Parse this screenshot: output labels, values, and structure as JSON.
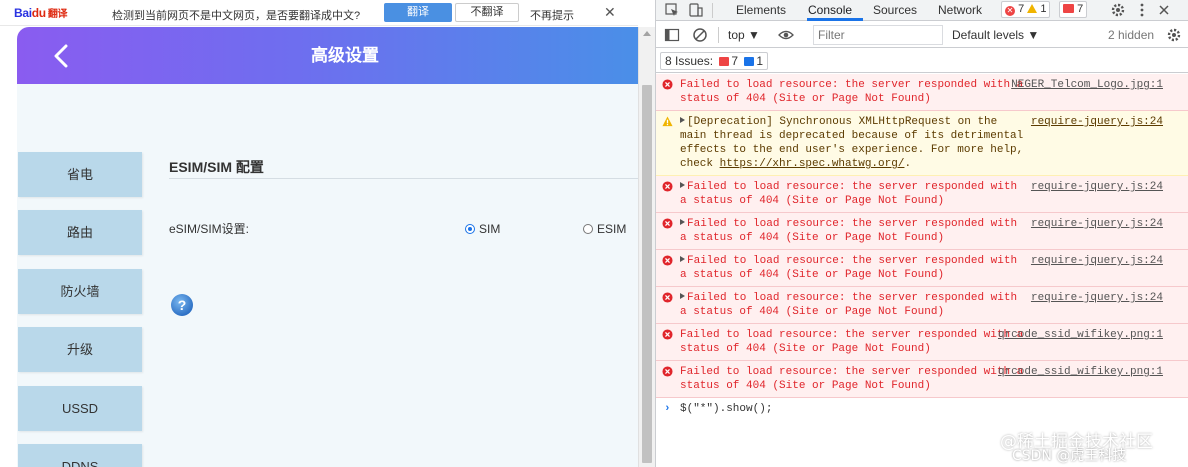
{
  "translate_bar": {
    "logo_text": "Bai",
    "logo_accent": "du",
    "logo_suffix": "翻译",
    "message": "检测到当前网页不是中文网页，是否要翻译成中文?",
    "translate_label": "翻译",
    "no_translate_label": "不翻译",
    "no_prompt_label": "不再提示",
    "close_glyph": "✕"
  },
  "page": {
    "header_title": "高级设置",
    "sidebar": [
      {
        "label": "省电"
      },
      {
        "label": "路由"
      },
      {
        "label": "防火墙"
      },
      {
        "label": "升级"
      },
      {
        "label": "USSD"
      },
      {
        "label": "DDNS"
      }
    ],
    "section_title": "ESIM/SIM 配置",
    "field_label": "eSIM/SIM设置:",
    "options": [
      {
        "label": "SIM",
        "selected": true
      },
      {
        "label": "ESIM",
        "selected": false
      }
    ],
    "help_glyph": "?"
  },
  "devtools": {
    "tabs": [
      "Elements",
      "Console",
      "Sources",
      "Network"
    ],
    "active_tab": "Console",
    "error_count": "7",
    "warning_count": "1",
    "issue_count": "7",
    "context": "top ▼",
    "filter_placeholder": "Filter",
    "levels": "Default levels ▼",
    "hidden": "2 hidden",
    "issues_label": "8 Issues:",
    "issues_errors": "7",
    "issues_info": "1",
    "messages": [
      {
        "level": "error",
        "expand": false,
        "text": "Failed to load resource: the server responded with a status of 404 (Site or Page Not Found)",
        "source": "NEGER_Telcom_Logo.jpg:1"
      },
      {
        "level": "warn",
        "expand": true,
        "text": "[Deprecation] Synchronous XMLHttpRequest on the main thread is deprecated because of its detrimental effects to the end user's experience. For more help, check ",
        "link": "https://xhr.spec.whatwg.org/",
        "after": ".",
        "source": "require-jquery.js:24"
      },
      {
        "level": "error",
        "expand": true,
        "text": "Failed to load resource: the server responded with a status of 404 (Site or Page Not Found)",
        "source": "require-jquery.js:24"
      },
      {
        "level": "error",
        "expand": true,
        "text": "Failed to load resource: the server responded with a status of 404 (Site or Page Not Found)",
        "source": "require-jquery.js:24"
      },
      {
        "level": "error",
        "expand": true,
        "text": "Failed to load resource: the server responded with a status of 404 (Site or Page Not Found)",
        "source": "require-jquery.js:24"
      },
      {
        "level": "error",
        "expand": true,
        "text": "Failed to load resource: the server responded with a status of 404 (Site or Page Not Found)",
        "source": "require-jquery.js:24"
      },
      {
        "level": "error",
        "expand": false,
        "text": "Failed to load resource: the server responded with a status of 404 (Site or Page Not Found)",
        "source": "qrcode_ssid_wifikey.png:1"
      },
      {
        "level": "error",
        "expand": false,
        "text": "Failed to load resource: the server responded with a status of 404 (Site or Page Not Found)",
        "source": "qrcode_ssid_wifikey.png:1"
      }
    ],
    "prompt_input": "$(\"*\").show();"
  },
  "watermark": {
    "line1": "@稀土掘金技术社区",
    "line2": "CSDN @虎王科技"
  },
  "colors": {
    "header_start": "#8a5cf0",
    "header_end": "#4a8fe8",
    "sidebar_button": "#b9d8ea",
    "error_text": "#e0252b",
    "accent": "#1a73e8"
  }
}
